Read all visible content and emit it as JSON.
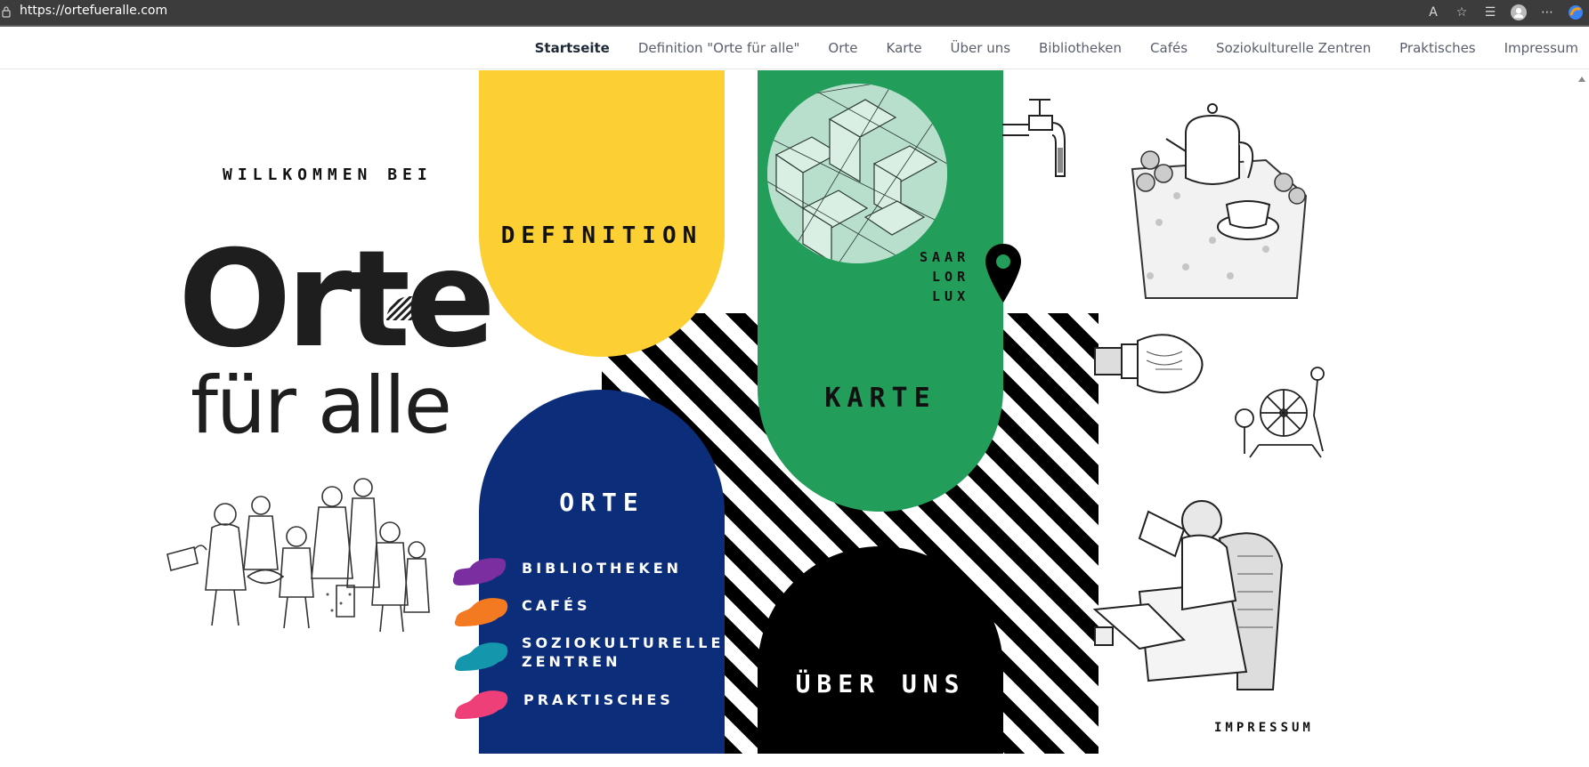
{
  "browser": {
    "url": "https://ortefueralle.com"
  },
  "nav": {
    "items": [
      {
        "label": "Startseite",
        "active": true
      },
      {
        "label": "Definition \"Orte für alle\""
      },
      {
        "label": "Orte"
      },
      {
        "label": "Karte"
      },
      {
        "label": "Über uns"
      },
      {
        "label": "Bibliotheken"
      },
      {
        "label": "Cafés"
      },
      {
        "label": "Soziokulturelle Zentren"
      },
      {
        "label": "Praktisches"
      },
      {
        "label": "Impressum"
      }
    ]
  },
  "hero": {
    "welcome": "WILLKOMMEN BEI",
    "logo_line1": "Orte",
    "logo_line2": "für alle"
  },
  "tiles": {
    "definition": "DEFINITION",
    "karte": "KARTE",
    "saar_line1": "SAAR",
    "saar_line2": "LOR",
    "saar_line3": "LUX",
    "orte": "ORTE",
    "uber_uns": "ÜBER UNS"
  },
  "orte_menu": {
    "bibliotheken": "BIBLIOTHEKEN",
    "cafes": "CAFÉS",
    "sozio_line1": "SOZIOKULTURELLE",
    "sozio_line2": "ZENTREN",
    "praktisches": "PRAKTISCHES"
  },
  "footer_link": "IMPRESSUM",
  "colors": {
    "yellow": "#fccf33",
    "green": "#239d5a",
    "blue": "#0b2d7a",
    "purple": "#7b2ea0",
    "orange": "#f47a22",
    "teal": "#1496ad",
    "pink": "#ef3f78"
  }
}
